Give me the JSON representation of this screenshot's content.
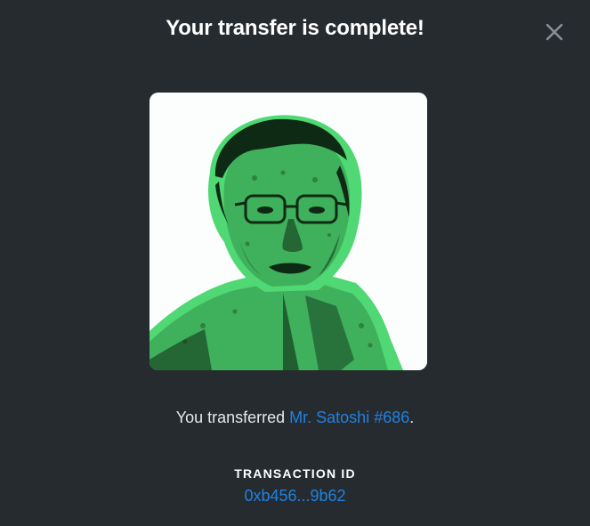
{
  "modal": {
    "title": "Your transfer is complete!",
    "close_icon": "close-icon"
  },
  "nft": {
    "image_icon": "nft-portrait-image",
    "colors": {
      "background": "#fbfefd",
      "halo": "#4fd873",
      "skin": "#3fb05b",
      "shadow": "#0e2a14"
    }
  },
  "summary": {
    "prefix": "You transferred ",
    "item_name": "Mr. Satoshi #686",
    "suffix": "."
  },
  "transaction": {
    "label": "TRANSACTION ID",
    "id": "0xb456...9b62"
  },
  "colors": {
    "background": "#262b2f",
    "link": "#2081e2",
    "text": "#e5e8eb",
    "title": "#ffffff"
  }
}
